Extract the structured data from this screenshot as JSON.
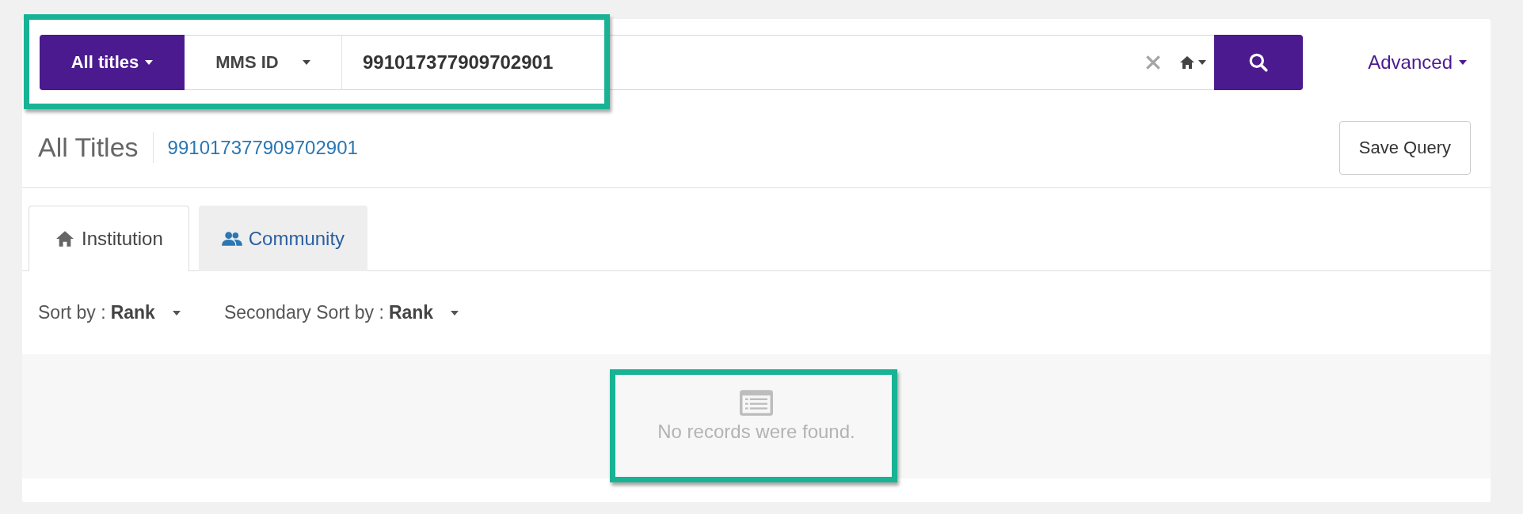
{
  "search_bar": {
    "scope": "All titles",
    "field": "MMS ID",
    "query": "991017377909702901",
    "advanced": "Advanced"
  },
  "title": {
    "heading": "All Titles",
    "query_link": "991017377909702901"
  },
  "save_button": "Save Query",
  "tabs": [
    {
      "label": "Institution",
      "selected": true
    },
    {
      "label": "Community",
      "selected": false
    }
  ],
  "sorts": [
    {
      "label": "Sort by :",
      "value": "Rank"
    },
    {
      "label": "Secondary Sort by :",
      "value": "Rank"
    }
  ],
  "results": {
    "message": "No records were found."
  }
}
